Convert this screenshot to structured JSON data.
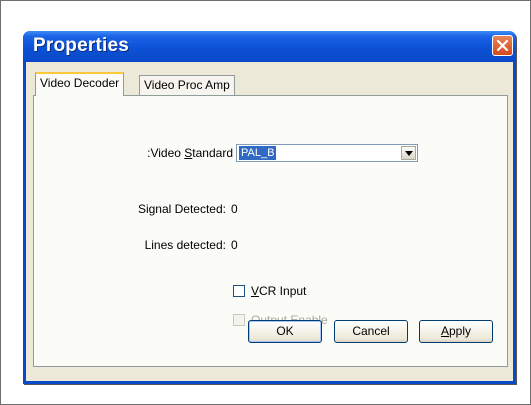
{
  "window": {
    "title": "Properties",
    "close_icon": "close-icon"
  },
  "tabs": [
    {
      "label": "Video Decoder",
      "active": true
    },
    {
      "label": "Video Proc Amp",
      "active": false
    }
  ],
  "video_decoder": {
    "video_standard_prefix": ":Video ",
    "video_standard_underline": "S",
    "video_standard_suffix": "tandard",
    "video_standard_value": "PAL_B",
    "signal_detected_label": "Signal Detected:",
    "signal_detected_value": "0",
    "lines_detected_label": "Lines detected:",
    "lines_detected_value": "0",
    "vcr_input_underline": "V",
    "vcr_input_rest": "CR Input",
    "vcr_input_checked": false,
    "output_enable_underline": "O",
    "output_enable_rest": "utput Enable",
    "output_enable_checked": false,
    "output_enable_disabled": true
  },
  "buttons": {
    "ok": "OK",
    "cancel": "Cancel",
    "apply_underline": "A",
    "apply_rest": "pply"
  },
  "colors": {
    "titlebar": "#0a49c7",
    "dialog_bg": "#ece9d8",
    "close_button": "#d34a1c",
    "selection": "#316ac5"
  }
}
